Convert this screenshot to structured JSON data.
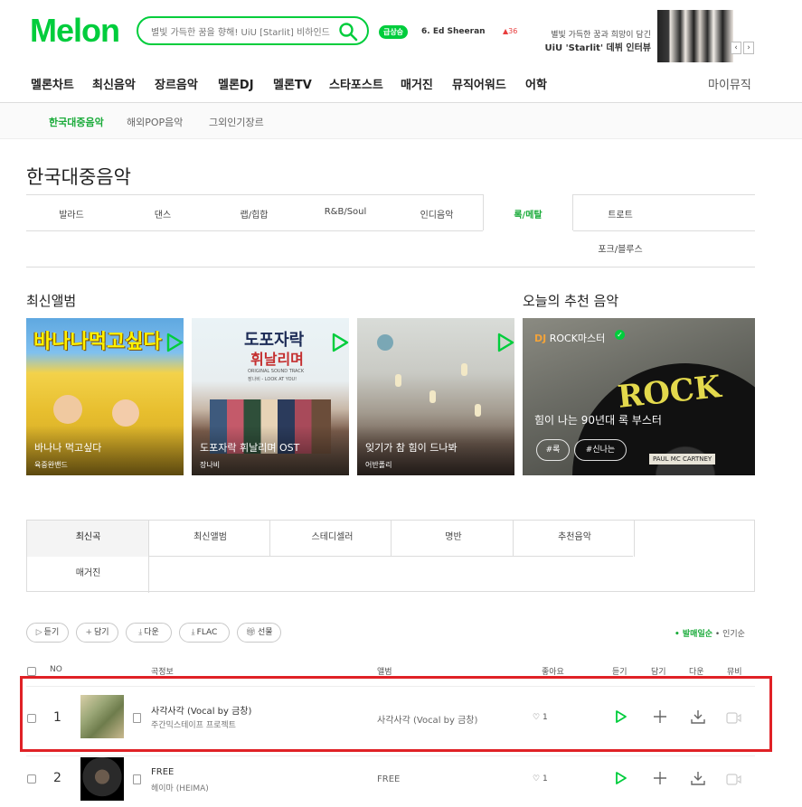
{
  "header": {
    "logo": "Melon",
    "search_placeholder": "별빛 가득한 꿈을 향해! UiU [Starlit] 비하인드",
    "rise_badge": "급상승",
    "rising_rank": "6. Ed Sheeran",
    "rising_change": "▲36",
    "promo_line1": "별빛 가득한 꿈과 희망이 담긴",
    "promo_line2": "UiU 'Starlit' 데뷔 인터뷰",
    "promo_prev": "‹",
    "promo_next": "›"
  },
  "gnb": [
    "멜론차트",
    "최신음악",
    "장르음악",
    "멜론DJ",
    "멜론TV",
    "스타포스트",
    "매거진",
    "뮤직어워드",
    "어학"
  ],
  "my_music": "마이뮤직",
  "subnav": [
    "한국대중음악",
    "해외POP음악",
    "그외인기장르"
  ],
  "page_title": "한국대중음악",
  "genres": [
    "발라드",
    "댄스",
    "랩/힙합",
    "R&B/Soul",
    "인디음악",
    "록/메탈",
    "트로트",
    "포크/블루스"
  ],
  "active_genre": "록/메탈",
  "latest_albums_title": "최신앨범",
  "recommend_title": "오늘의 추천 음악",
  "albums": [
    {
      "title": "바나나 먹고싶다",
      "artist": "육중완밴드",
      "cover_text": "바나나먹고싶다"
    },
    {
      "title": "도포자락 휘날리며 OST",
      "artist": "장나비",
      "cover_text1": "도포자락",
      "cover_text2": "휘날리며",
      "cover_sub": "ORIGINAL SOUND TRACK",
      "cover_sub2": "장나비 - LOOK AT YOU!"
    },
    {
      "title": "잊기가 참 힘이 드나봐",
      "artist": "어반폴리"
    }
  ],
  "recommend": {
    "dj_label": "DJ",
    "dj_name": "ROCK마스터",
    "title": "힘이 나는 90년대 록 부스터",
    "tags": [
      "#록",
      "#신나는"
    ],
    "cover_word": "ROCK",
    "vinyl_label": "PAUL MC CARTNEY"
  },
  "tabs": [
    "최신곡",
    "최신앨범",
    "스테디셀러",
    "명반",
    "추천음악",
    "매거진"
  ],
  "actions": [
    "듣기",
    "담기",
    "다운",
    "FLAC",
    "선물"
  ],
  "sort": {
    "active": "발매일순",
    "other": "인기순"
  },
  "table_headers": [
    "NO",
    "곡정보",
    "앨범",
    "좋아요",
    "듣기",
    "담기",
    "다운",
    "뮤비"
  ],
  "rows": [
    {
      "no": "1",
      "title": "사각사각 (Vocal by 금창)",
      "artist": "주간믹스테이프 프로젝트",
      "album": "사각사각 (Vocal by 금창)",
      "likes": "1"
    },
    {
      "no": "2",
      "title": "FREE",
      "artist": "헤이마 (HEIMA)",
      "album": "FREE",
      "likes": "1"
    }
  ],
  "colors": {
    "brand": "#00cd3c",
    "active_text": "#1aab3a",
    "highlight_box": "#e02126"
  }
}
